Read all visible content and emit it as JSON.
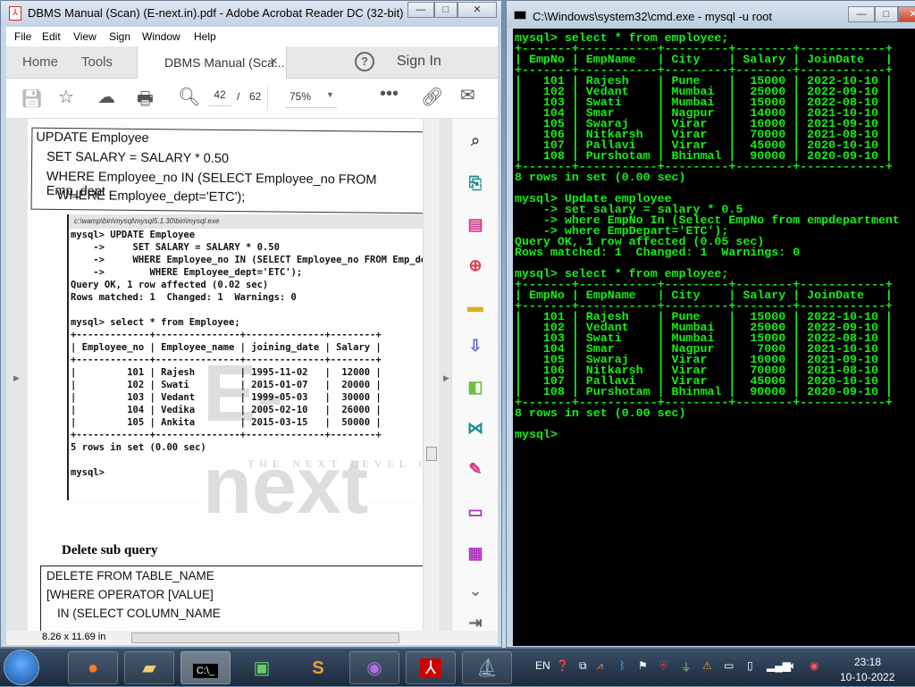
{
  "acrobat": {
    "title": "DBMS Manual (Scan) (E-next.in).pdf - Adobe Acrobat Reader DC (32-bit)",
    "menu": [
      "File",
      "Edit",
      "View",
      "Sign",
      "Window",
      "Help"
    ],
    "tabs": {
      "home": "Home",
      "tools": "Tools",
      "document": "DBMS Manual (Sca...",
      "close": "×",
      "signin": "Sign In",
      "help": "?"
    },
    "toolbar": {
      "page_current": "42",
      "page_sep": "/",
      "page_total": "62",
      "zoom": "75%"
    },
    "status": {
      "size": "8.26 x 11.69 in"
    },
    "page": {
      "box1": [
        "UPDATE Employee",
        "SET SALARY = SALARY * 0.50",
        "WHERE Employee_no IN (SELECT Employee_no FROM Emp_dept",
        "WHERE Employee_dept='ETC');"
      ],
      "shot_title": "c:\\wamp\\bin\\mysql\\mysql5.1.30\\bin\\mysql.exe",
      "shot_lines": [
        "mysql> UPDATE Employee",
        "    ->     SET SALARY = SALARY * 0.50",
        "    ->     WHERE Employee_no IN (SELECT Employee_no FROM Emp_dept",
        "    ->        WHERE Employee_dept='ETC');",
        "Query OK, 1 row affected (0.02 sec)",
        "Rows matched: 1  Changed: 1  Warnings: 0",
        "",
        "mysql> select * from Employee;"
      ],
      "shot_table": {
        "headers": [
          "Employee_no",
          "Employee_name",
          "joining_date",
          "Salary"
        ],
        "rows": [
          [
            "101",
            "Rajesh",
            "1995-11-02",
            "12000"
          ],
          [
            "102",
            "Swati",
            "2015-01-07",
            "20000"
          ],
          [
            "103",
            "Vedant",
            "1999-05-03",
            "30000"
          ],
          [
            "104",
            "Vedika",
            "2005-02-10",
            "26000"
          ],
          [
            "105",
            "Ankita",
            "2015-03-15",
            "50000"
          ]
        ]
      },
      "shot_after": [
        "5 rows in set (0.00 sec)",
        "",
        "mysql>"
      ],
      "watermark": "E-next",
      "watermark_tag": "THE NEXT LEVEL O",
      "heading": "Delete sub query",
      "box2": [
        "DELETE FROM TABLE_NAME",
        "[WHERE OPERATOR [VALUE]",
        "IN (SELECT COLUMN_NAME"
      ]
    }
  },
  "cmd": {
    "title": "C:\\Windows\\system32\\cmd.exe - mysql  -u root",
    "color": "#14f014",
    "q1": "mysql> select * from employee;",
    "headers": [
      "EmpNo",
      "EmpName",
      "City",
      "Salary",
      "JoinDate"
    ],
    "rows": [
      [
        "101",
        "Rajesh",
        "Pune",
        "15000",
        "2022-10-10"
      ],
      [
        "102",
        "Vedant",
        "Mumbai",
        "25000",
        "2022-09-10"
      ],
      [
        "103",
        "Swati",
        "Mumbai",
        "15000",
        "2022-08-10"
      ],
      [
        "104",
        "Smar",
        "Nagpur",
        "14000",
        "2021-10-10"
      ],
      [
        "105",
        "Swaraj",
        "Virar",
        "16000",
        "2021-09-10"
      ],
      [
        "106",
        "Nitkarsh",
        "Virar",
        "70000",
        "2021-08-10"
      ],
      [
        "107",
        "Pallavi",
        "Virar",
        "45000",
        "2020-10-10"
      ],
      [
        "108",
        "Purshotam",
        "Bhinmal",
        "90000",
        "2020-09-10"
      ]
    ],
    "rows_after": [
      [
        "101",
        "Rajesh",
        "Pune",
        "15000",
        "2022-10-10"
      ],
      [
        "102",
        "Vedant",
        "Mumbai",
        "25000",
        "2022-09-10"
      ],
      [
        "103",
        "Swati",
        "Mumbai",
        "15000",
        "2022-08-10"
      ],
      [
        "104",
        "Smar",
        "Nagpur",
        "7000",
        "2021-10-10"
      ],
      [
        "105",
        "Swaraj",
        "Virar",
        "16000",
        "2021-09-10"
      ],
      [
        "106",
        "Nitkarsh",
        "Virar",
        "70000",
        "2021-08-10"
      ],
      [
        "107",
        "Pallavi",
        "Virar",
        "45000",
        "2020-10-10"
      ],
      [
        "108",
        "Purshotam",
        "Bhinmal",
        "90000",
        "2020-09-10"
      ]
    ],
    "set1": "8 rows in set (0.00 sec)",
    "update": [
      "mysql> Update employee",
      "    -> set salary = salary * 0.5",
      "    -> where EmpNo In (Select EmpNo from empdepartment",
      "    -> where EmpDepart='ETC');",
      "Query OK, 1 row affected (0.05 sec)",
      "Rows matched: 1  Changed: 1  Warnings: 0"
    ],
    "q2": "mysql> select * from employee;",
    "set2": "8 rows in set (0.00 sec)",
    "prompt": "mysql>"
  },
  "taskbar": {
    "lang": "EN",
    "time": "23:18",
    "date": "10-10-2022"
  }
}
